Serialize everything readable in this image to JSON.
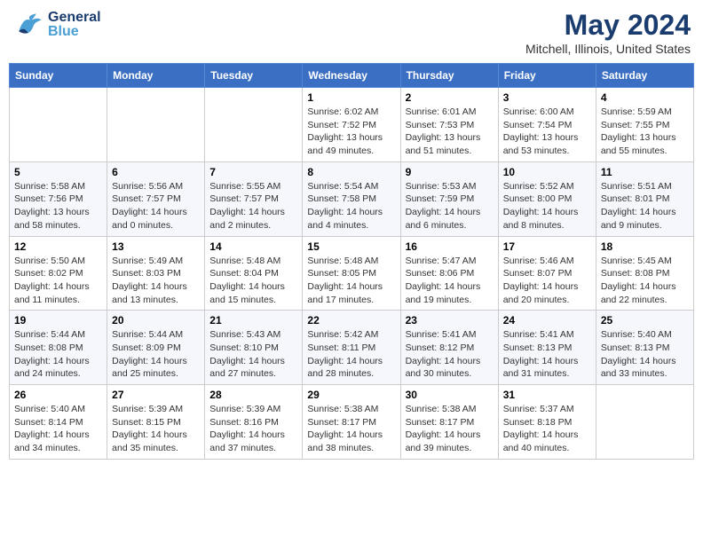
{
  "header": {
    "logo_general": "General",
    "logo_blue": "Blue",
    "title": "May 2024",
    "subtitle": "Mitchell, Illinois, United States"
  },
  "calendar": {
    "days_of_week": [
      "Sunday",
      "Monday",
      "Tuesday",
      "Wednesday",
      "Thursday",
      "Friday",
      "Saturday"
    ],
    "weeks": [
      [
        {
          "day": "",
          "info": ""
        },
        {
          "day": "",
          "info": ""
        },
        {
          "day": "",
          "info": ""
        },
        {
          "day": "1",
          "info": "Sunrise: 6:02 AM\nSunset: 7:52 PM\nDaylight: 13 hours and 49 minutes."
        },
        {
          "day": "2",
          "info": "Sunrise: 6:01 AM\nSunset: 7:53 PM\nDaylight: 13 hours and 51 minutes."
        },
        {
          "day": "3",
          "info": "Sunrise: 6:00 AM\nSunset: 7:54 PM\nDaylight: 13 hours and 53 minutes."
        },
        {
          "day": "4",
          "info": "Sunrise: 5:59 AM\nSunset: 7:55 PM\nDaylight: 13 hours and 55 minutes."
        }
      ],
      [
        {
          "day": "5",
          "info": "Sunrise: 5:58 AM\nSunset: 7:56 PM\nDaylight: 13 hours and 58 minutes."
        },
        {
          "day": "6",
          "info": "Sunrise: 5:56 AM\nSunset: 7:57 PM\nDaylight: 14 hours and 0 minutes."
        },
        {
          "day": "7",
          "info": "Sunrise: 5:55 AM\nSunset: 7:57 PM\nDaylight: 14 hours and 2 minutes."
        },
        {
          "day": "8",
          "info": "Sunrise: 5:54 AM\nSunset: 7:58 PM\nDaylight: 14 hours and 4 minutes."
        },
        {
          "day": "9",
          "info": "Sunrise: 5:53 AM\nSunset: 7:59 PM\nDaylight: 14 hours and 6 minutes."
        },
        {
          "day": "10",
          "info": "Sunrise: 5:52 AM\nSunset: 8:00 PM\nDaylight: 14 hours and 8 minutes."
        },
        {
          "day": "11",
          "info": "Sunrise: 5:51 AM\nSunset: 8:01 PM\nDaylight: 14 hours and 9 minutes."
        }
      ],
      [
        {
          "day": "12",
          "info": "Sunrise: 5:50 AM\nSunset: 8:02 PM\nDaylight: 14 hours and 11 minutes."
        },
        {
          "day": "13",
          "info": "Sunrise: 5:49 AM\nSunset: 8:03 PM\nDaylight: 14 hours and 13 minutes."
        },
        {
          "day": "14",
          "info": "Sunrise: 5:48 AM\nSunset: 8:04 PM\nDaylight: 14 hours and 15 minutes."
        },
        {
          "day": "15",
          "info": "Sunrise: 5:48 AM\nSunset: 8:05 PM\nDaylight: 14 hours and 17 minutes."
        },
        {
          "day": "16",
          "info": "Sunrise: 5:47 AM\nSunset: 8:06 PM\nDaylight: 14 hours and 19 minutes."
        },
        {
          "day": "17",
          "info": "Sunrise: 5:46 AM\nSunset: 8:07 PM\nDaylight: 14 hours and 20 minutes."
        },
        {
          "day": "18",
          "info": "Sunrise: 5:45 AM\nSunset: 8:08 PM\nDaylight: 14 hours and 22 minutes."
        }
      ],
      [
        {
          "day": "19",
          "info": "Sunrise: 5:44 AM\nSunset: 8:08 PM\nDaylight: 14 hours and 24 minutes."
        },
        {
          "day": "20",
          "info": "Sunrise: 5:44 AM\nSunset: 8:09 PM\nDaylight: 14 hours and 25 minutes."
        },
        {
          "day": "21",
          "info": "Sunrise: 5:43 AM\nSunset: 8:10 PM\nDaylight: 14 hours and 27 minutes."
        },
        {
          "day": "22",
          "info": "Sunrise: 5:42 AM\nSunset: 8:11 PM\nDaylight: 14 hours and 28 minutes."
        },
        {
          "day": "23",
          "info": "Sunrise: 5:41 AM\nSunset: 8:12 PM\nDaylight: 14 hours and 30 minutes."
        },
        {
          "day": "24",
          "info": "Sunrise: 5:41 AM\nSunset: 8:13 PM\nDaylight: 14 hours and 31 minutes."
        },
        {
          "day": "25",
          "info": "Sunrise: 5:40 AM\nSunset: 8:13 PM\nDaylight: 14 hours and 33 minutes."
        }
      ],
      [
        {
          "day": "26",
          "info": "Sunrise: 5:40 AM\nSunset: 8:14 PM\nDaylight: 14 hours and 34 minutes."
        },
        {
          "day": "27",
          "info": "Sunrise: 5:39 AM\nSunset: 8:15 PM\nDaylight: 14 hours and 35 minutes."
        },
        {
          "day": "28",
          "info": "Sunrise: 5:39 AM\nSunset: 8:16 PM\nDaylight: 14 hours and 37 minutes."
        },
        {
          "day": "29",
          "info": "Sunrise: 5:38 AM\nSunset: 8:17 PM\nDaylight: 14 hours and 38 minutes."
        },
        {
          "day": "30",
          "info": "Sunrise: 5:38 AM\nSunset: 8:17 PM\nDaylight: 14 hours and 39 minutes."
        },
        {
          "day": "31",
          "info": "Sunrise: 5:37 AM\nSunset: 8:18 PM\nDaylight: 14 hours and 40 minutes."
        },
        {
          "day": "",
          "info": ""
        }
      ]
    ]
  }
}
